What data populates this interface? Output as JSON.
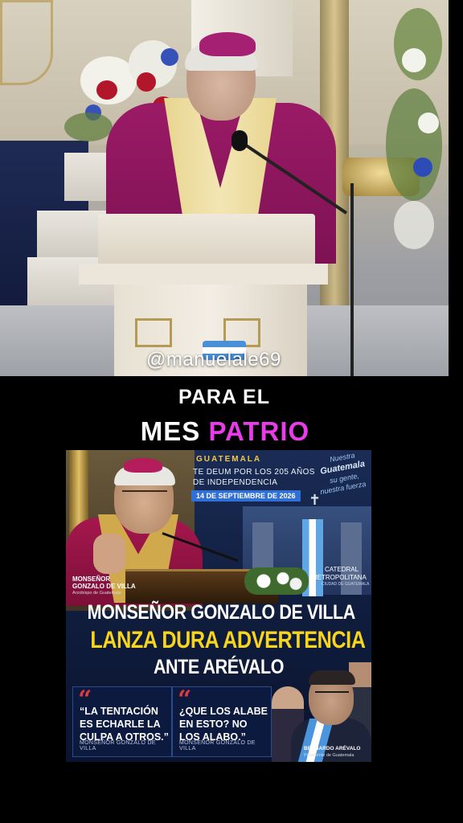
{
  "video": {
    "watermark": "@manuelale69"
  },
  "caption": {
    "line1": "PARA EL",
    "line2_white": "MES",
    "line2_highlight": "PATRIO"
  },
  "card": {
    "country": "GUATEMALA",
    "event_line1": "TE DEUM POR LOS 205 AÑOS",
    "event_line2": "DE INDEPENDENCIA",
    "date": "14 DE SEPTIEMBRE DE 2026",
    "slogan_line1": "Nuestra",
    "slogan_line2": "Guatemala",
    "slogan_line3": "su gente,",
    "slogan_line4": "nuestra fuerza",
    "place_line1": "CATEDRAL",
    "place_line2": "METROPOLITANA",
    "place_line3": "CIUDAD DE GUATEMALA",
    "speaker_title": "MONSEÑOR",
    "speaker_name": "GONZALO DE VILLA",
    "speaker_role": "Arzobispo de Guatemala",
    "headline1": "MONSEÑOR GONZALO DE VILLA",
    "headline2": "LANZA DURA ADVERTENCIA",
    "headline3": "ANTE ARÉVALO",
    "quotes": [
      {
        "mark": "“",
        "text": "“LA TENTACIÓN ES ECHARLE LA CULPA A OTROS.”",
        "author": "MONSEÑOR GONZALO DE VILLA"
      },
      {
        "mark": "“",
        "text": "¿QUE LOS ALABE EN ESTO? NO LOS ALABO.”",
        "author": "MONSEÑOR GONZALO DE VILLA"
      }
    ],
    "president_name": "BERNARDO ARÉVALO",
    "president_role": "Presidente de Guatemala",
    "colors": {
      "headline_white": "#ffffff",
      "headline_yellow": "#f7d51d",
      "accent_blue": "#2f6fd6",
      "quote_red": "#e23a3a",
      "caption_magenta": "#e83ce9"
    }
  }
}
